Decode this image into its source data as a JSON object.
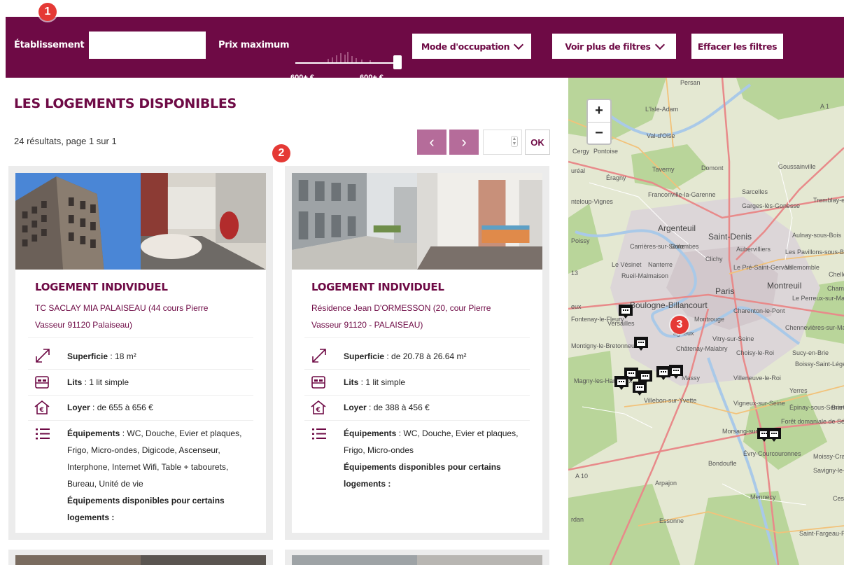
{
  "annotations": [
    "1",
    "2",
    "3"
  ],
  "filters": {
    "establishment_label": "Établissement",
    "establishment_value": "",
    "max_price_label": "Prix maximum",
    "price_min_value": "600+ €",
    "price_max_value": "600+ €",
    "occupation_mode_label": "Mode d'occupation",
    "more_filters_label": "Voir plus de filtres",
    "clear_filters_label": "Effacer les filtres"
  },
  "list": {
    "title": "LES LOGEMENTS DISPONIBLES",
    "results_text": "24 résultats, page 1 sur 1",
    "prev_label": "‹",
    "next_label": "›",
    "page_input_value": "",
    "ok_label": "OK"
  },
  "cards": [
    {
      "type": "LOGEMENT INDIVIDUEL",
      "address_line1": "TC SACLAY MIA PALAISEAU (44 cours Pierre",
      "address_line2": "Vasseur 91120 Palaiseau)",
      "surface_label": "Superficie",
      "surface_value": " : 18 m²",
      "beds_label": "Lits",
      "beds_value": " : 1 lit simple",
      "rent_label": "Loyer",
      "rent_value": " : de 655 à 656 €",
      "equip_label": "Équipements",
      "equip_value": " : WC, Douche, Evier et plaques, Frigo, Micro-ondes, Digicode, Ascenseur, Interphone, Internet Wifi, Table + tabourets, Bureau, Unité de vie",
      "equip_some_label": "Équipements disponibles pour certains logements :"
    },
    {
      "type": "LOGEMENT INDIVIDUEL",
      "address_line1": "Résidence Jean D'ORMESSON (20, cour Pierre",
      "address_line2": "Vasseur 91120 - PALAISEAU)",
      "surface_label": "Superficie",
      "surface_value": " : de 20.78 à 26.64 m²",
      "beds_label": "Lits",
      "beds_value": " : 1 lit simple",
      "rent_label": "Loyer",
      "rent_value": " : de 388 à 456 €",
      "equip_label": "Équipements",
      "equip_value": " : WC, Douche, Evier et plaques, Frigo, Micro-ondes",
      "equip_some_label": "Équipements disponibles pour certains logements :"
    }
  ],
  "map": {
    "zoom_in": "+",
    "zoom_out": "−",
    "labels": {
      "persan": "Persan",
      "lisle_adam": "L'Isle-Adam",
      "a1": "A 1",
      "cergy": "Cergy",
      "pontoise": "Pontoise",
      "vaux": "Val-d'Oise",
      "taverny": "Taverny",
      "domont": "Domont",
      "goussainville": "Goussainville",
      "ureal": "uréal",
      "eragny": "Éragny",
      "sarcelles": "Sarcelles",
      "tremblay": "Tremblay-en-France",
      "franconville": "Franconville-la-Garenne",
      "garges": "Garges-lès-Gonesse",
      "conflans": "nteloup-Vignes",
      "argenteuil": "Argenteuil",
      "saint_denis": "Saint-Denis",
      "aulnay": "Aulnay-sous-Bois",
      "poissy": "Poissy",
      "carrieres": "Carrières-sur-Seine",
      "colombes": "Colombes",
      "aubervilliers": "Aubervilliers",
      "pavillons": "Les Pavillons-sous-Bois",
      "clichy": "Clichy",
      "vesinet": "Le Vésinet",
      "nanterre": "Nanterre",
      "pre_st_gervais": "Le Pré-Saint-Gervais",
      "villemomble": "Villemomble",
      "chelles": "Chelle",
      "a13": "13",
      "rueil": "Rueil-Malmaison",
      "paris": "Paris",
      "montreuil": "Montreuil",
      "champs": "Champ",
      "perreux": "Le Perreux-sur-Marne",
      "boulogne": "Boulogne-Billancourt",
      "eux": "eux",
      "charenton": "Charenton-le-Pont",
      "fontenay": "Fontenay-le-Fleury",
      "versailles": "Versailles",
      "montrouge": "Montrouge",
      "chennevieres": "Chennevières-sur-Marne",
      "bagneux": "agneux",
      "vitry": "Vitry-sur-Seine",
      "montigny": "Montigny-le-Bretonneux",
      "chatenay": "Châtenay-Malabry",
      "choisy": "Choisy-le-Roi",
      "sucy": "Sucy-en-Brie",
      "boissy": "Boissy-Saint-Léger",
      "magny": "Magny-les-Hameaux",
      "massy": "Massy",
      "villeneuve": "Villeneuve-le-Roi",
      "villebon": "Villebon-sur-Yvette",
      "yerres": "Yerres",
      "vigneux": "Vigneux-sur-Seine",
      "epinay": "Épinay-sous-Sénart",
      "brie": "Brie-",
      "foret_senart": "Forêt domaniale de Sénart",
      "morsang": "Morsang-sur-Orge",
      "evry": "Évry-Courcouronnes",
      "moissy": "Moissy-Cra",
      "bondoufle": "Bondoufle",
      "savigny": "Savigny-le-Temple",
      "a10": "A 10",
      "arpajon": "Arpajon",
      "mennecy": "Mennecy",
      "cesson": "Cess",
      "rdan": "rdan",
      "essonne": "Essonne",
      "saint_fargeau": "Saint-Fargeau-Ponthierry"
    }
  }
}
